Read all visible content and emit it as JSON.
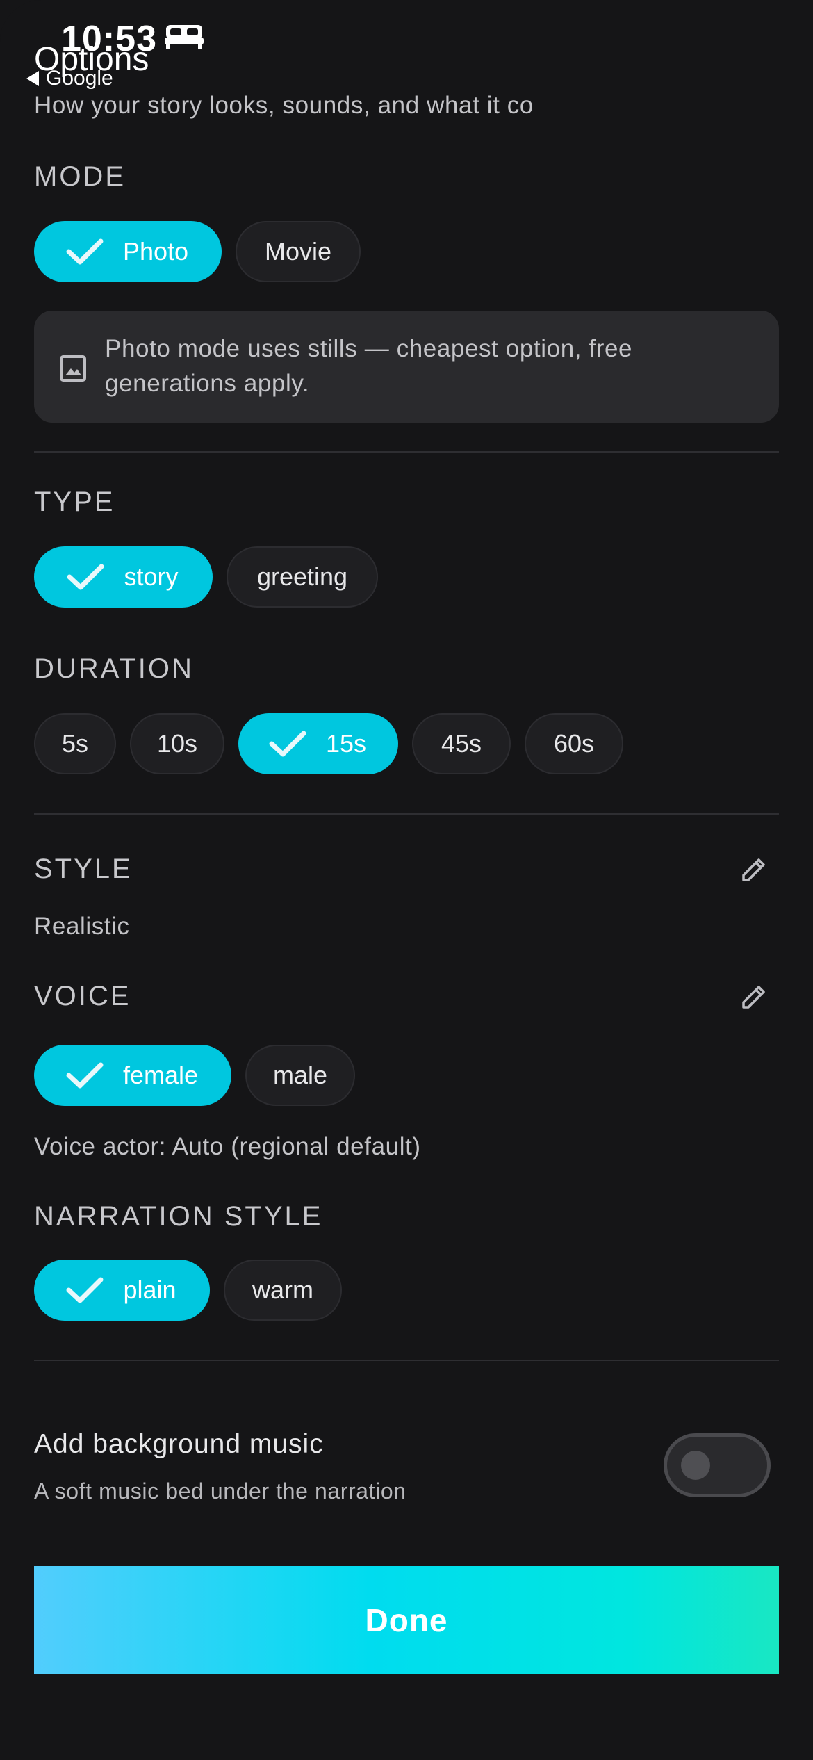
{
  "status_bar": {
    "time": "10:53",
    "back_app": "Google"
  },
  "header": {
    "title": "Options",
    "subtitle": "How your story looks, sounds, and what it co"
  },
  "mode": {
    "label": "MODE",
    "options": [
      "Photo",
      "Movie"
    ],
    "selected": "Photo",
    "info": "Photo mode uses stills — cheapest option, free generations apply."
  },
  "type": {
    "label": "TYPE",
    "options": [
      "story",
      "greeting"
    ],
    "selected": "story"
  },
  "duration": {
    "label": "DURATION",
    "options": [
      "5s",
      "10s",
      "15s",
      "45s",
      "60s"
    ],
    "selected": "15s"
  },
  "style": {
    "label": "STYLE",
    "value": "Realistic"
  },
  "voice": {
    "label": "VOICE",
    "options": [
      "female",
      "male"
    ],
    "selected": "female",
    "actor": "Voice actor: Auto (regional default)"
  },
  "narration": {
    "label": "NARRATION STYLE",
    "options": [
      "plain",
      "warm"
    ],
    "selected": "plain"
  },
  "music": {
    "title": "Add background music",
    "subtitle": "A soft music bed under the narration",
    "enabled": false
  },
  "done_label": "Done",
  "colors": {
    "accent": "#00c7df",
    "background": "#151517",
    "chip": "#1f1f22"
  }
}
